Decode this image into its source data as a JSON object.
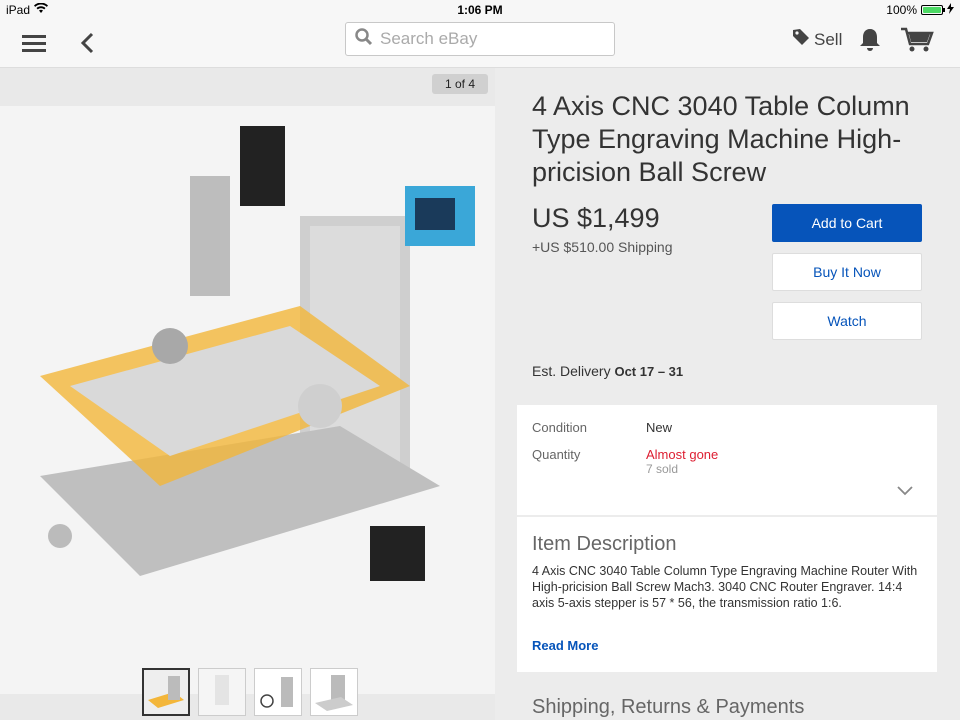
{
  "status_bar": {
    "device": "iPad",
    "time": "1:06 PM",
    "battery": "100%",
    "battery_level": 1.0
  },
  "nav": {
    "search_placeholder": "Search eBay",
    "sell_label": "Sell"
  },
  "media": {
    "counter": "1 of 4",
    "thumbnails": [
      "thumb-1",
      "thumb-2",
      "thumb-3",
      "thumb-4"
    ],
    "active_thumbnail": 1
  },
  "item": {
    "title": "4 Axis CNC 3040 Table Column Type Engraving Machine High-pricision Ball Screw",
    "price": "US $1,499",
    "shipping": "+US $510.00 Shipping",
    "delivery_label": "Est. Delivery",
    "delivery_dates": "Oct 17 – 31"
  },
  "actions": {
    "add_to_cart": "Add to Cart",
    "buy_it_now": "Buy It Now",
    "watch": "Watch"
  },
  "specs": {
    "condition_label": "Condition",
    "condition_value": "New",
    "quantity_label": "Quantity",
    "quantity_status": "Almost gone",
    "quantity_sold": "7 sold"
  },
  "description": {
    "heading": "Item Description",
    "body": "4 Axis CNC 3040 Table Column  Type Engraving Machine Router With High-pricision Ball Screw Mach3. 3040 CNC Router Engraver. 14:4 axis 5-axis stepper is 57 * 56, the transmission ratio 1:6.",
    "read_more": "Read More"
  },
  "sections": {
    "shipping_returns": "Shipping, Returns & Payments"
  },
  "colors": {
    "primary_blue": "#0654ba",
    "alert_red": "#dd1e31",
    "battery_green": "#4cd964"
  }
}
